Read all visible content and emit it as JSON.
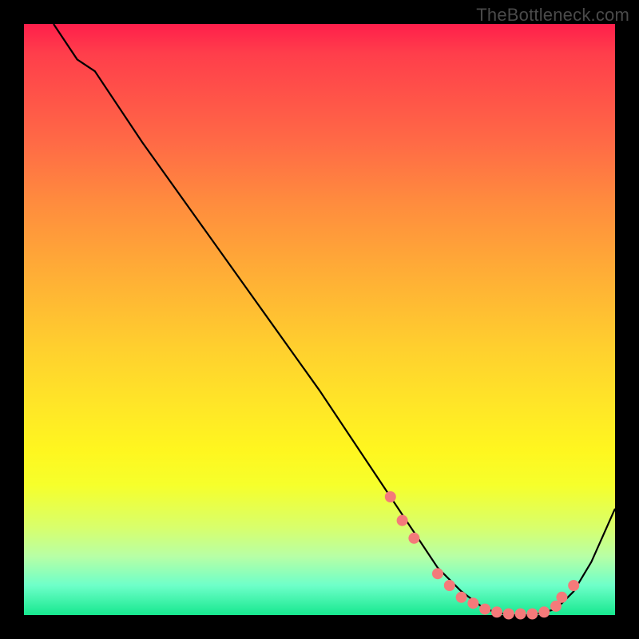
{
  "watermark": "TheBottleneck.com",
  "chart_data": {
    "type": "line",
    "title": "",
    "xlabel": "",
    "ylabel": "",
    "xlim": [
      0,
      100
    ],
    "ylim": [
      0,
      100
    ],
    "grid": false,
    "legend": false,
    "series": [
      {
        "name": "curve",
        "x": [
          5,
          9,
          12,
          20,
          30,
          40,
          50,
          58,
          62,
          66,
          70,
          74,
          78,
          82,
          86,
          90,
          93,
          96,
          100
        ],
        "y": [
          100,
          94,
          92,
          80,
          66,
          52,
          38,
          26,
          20,
          14,
          8,
          4,
          1,
          0,
          0,
          1,
          4,
          9,
          18
        ]
      }
    ],
    "markers": {
      "name": "dots",
      "color": "#f47a7a",
      "radius": 7,
      "x": [
        62,
        64,
        66,
        70,
        72,
        74,
        76,
        78,
        80,
        82,
        84,
        86,
        88,
        90,
        91,
        93
      ],
      "y": [
        20,
        16,
        13,
        7,
        5,
        3,
        2,
        1,
        0.5,
        0.2,
        0.2,
        0.2,
        0.5,
        1.5,
        3,
        5
      ]
    },
    "colors": {
      "curve_stroke": "#000000",
      "marker_fill": "#f47a7a",
      "bg_top": "#ff1f4b",
      "bg_bottom": "#17e88f",
      "frame": "#000000"
    }
  }
}
